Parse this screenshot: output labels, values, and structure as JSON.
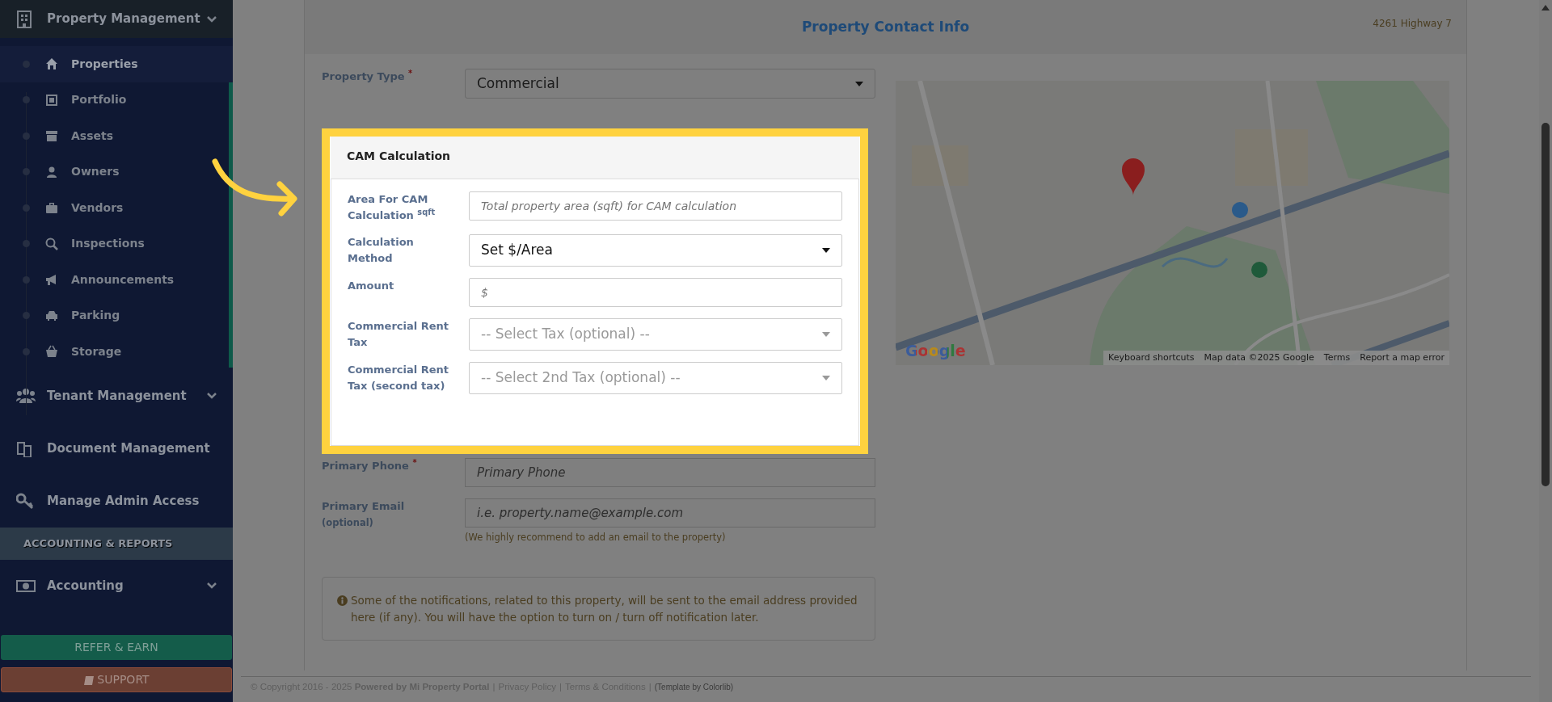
{
  "sidebar": {
    "items": [
      {
        "kind": "group",
        "label": "Property Management",
        "children": [
          {
            "label": "Properties",
            "selected": true
          },
          {
            "label": "Portfolio",
            "selected": false
          },
          {
            "label": "Assets",
            "selected": false
          },
          {
            "label": "Owners",
            "selected": false
          },
          {
            "label": "Vendors",
            "selected": false
          },
          {
            "label": "Inspections",
            "selected": false
          },
          {
            "label": "Announcements",
            "selected": false
          },
          {
            "label": "Parking",
            "selected": false
          },
          {
            "label": "Storage",
            "selected": false
          }
        ]
      },
      {
        "kind": "group",
        "label": "Tenant Management"
      },
      {
        "kind": "link",
        "label": "Document Management"
      },
      {
        "kind": "link",
        "label": "Manage Admin Access"
      },
      {
        "kind": "heading",
        "label": "ACCOUNTING & REPORTS"
      },
      {
        "kind": "group",
        "label": "Accounting"
      }
    ],
    "buttons": [
      {
        "kind": "refer",
        "label": "REFER & EARN"
      },
      {
        "kind": "support",
        "label": "SUPPORT"
      }
    ]
  },
  "panel": {
    "title": "Property Contact Info",
    "address": "4261 Highway 7"
  },
  "property_type": {
    "label": "Property Type",
    "required_mark": "*",
    "value": "Commercial"
  },
  "cam_card": {
    "title": "CAM Calculation",
    "fields": [
      {
        "kind": "input",
        "label": "Area For CAM Calculation",
        "unit": "sqft",
        "placeholder": "Total property area (sqft) for CAM calculation"
      },
      {
        "kind": "select",
        "label": "Calculation Method",
        "value": "Set $/Area"
      },
      {
        "kind": "input",
        "label": "Amount",
        "placeholder": "$"
      },
      {
        "kind": "select",
        "label": "Commercial Rent Tax",
        "placeholder": "-- Select Tax (optional) --"
      },
      {
        "kind": "select",
        "label": "Commercial Rent Tax (second tax)",
        "placeholder": "-- Select 2nd Tax (optional) --"
      }
    ]
  },
  "contact": [
    {
      "label": "Primary Phone",
      "required_mark": "*",
      "placeholder": "Primary Phone"
    },
    {
      "label": "Primary Email",
      "note": "(optional)",
      "placeholder": "i.e. property.name@example.com",
      "help": "(We highly recommend to add an email to the property)"
    }
  ],
  "notice": "Some of the notifications, related to this property, will be sent to the email address provided here (if any). You will have the option to turn on / turn off notification later.",
  "map": {
    "kind": "picture",
    "logo": "Google",
    "attribution": [
      "Keyboard shortcuts",
      "Map data ©2025 Google",
      "Terms",
      "Report a map error"
    ]
  },
  "footer": {
    "copyright": "© Copyright 2016 - 2025 **Powered by Mi Property Portal**",
    "separator": "|",
    "links": [
      "Privacy Policy",
      "Terms & Conditions"
    ],
    "credit": "(Template by Colorlib)"
  }
}
